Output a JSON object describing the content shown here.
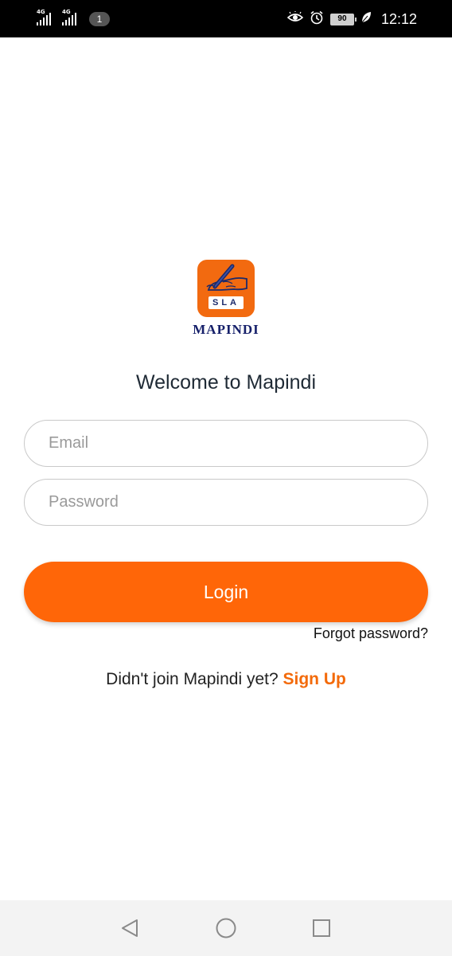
{
  "status_bar": {
    "network_1": "4G",
    "network_2": "4G",
    "notification_count": "1",
    "battery": "90",
    "time": "12:12",
    "icons": [
      "eye-comfort-icon",
      "alarm-icon",
      "battery-icon",
      "leaf-icon"
    ]
  },
  "logo": {
    "badge_text": "SLA",
    "brand_name": "MAPINDI",
    "badge_color": "#f26a10",
    "brand_color": "#16206a"
  },
  "login": {
    "title": "Welcome to Mapindi",
    "email_placeholder": "Email",
    "password_placeholder": "Password",
    "login_label": "Login",
    "forgot_label": "Forgot password?",
    "signup_prompt": "Didn't join Mapindi yet?",
    "signup_label": "Sign Up",
    "accent_color": "#ff6608"
  },
  "nav_bar": {
    "icons": [
      "back-icon",
      "home-icon",
      "recents-icon"
    ]
  }
}
